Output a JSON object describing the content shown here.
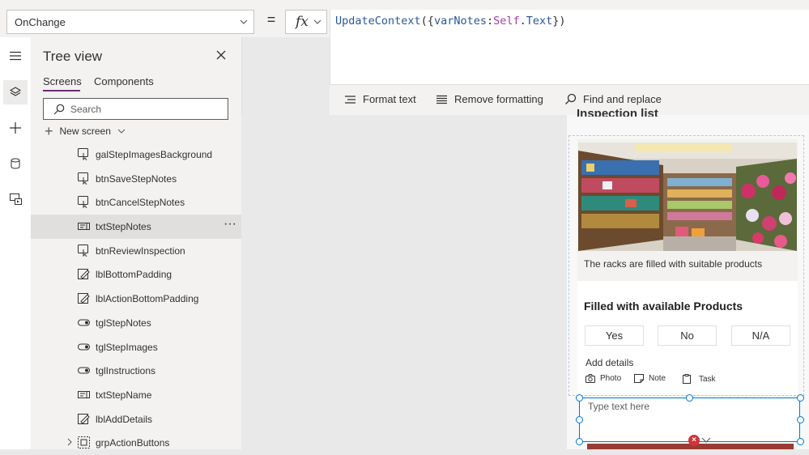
{
  "formula_bar": {
    "property": "OnChange",
    "equals": "=",
    "fx": "fx",
    "formula": {
      "fn": "UpdateContext",
      "open": "({",
      "var": "varNotes",
      "colon": ":",
      "self": "Self",
      "dot": ".",
      "prop": "Text",
      "close": "})"
    },
    "toolbar": {
      "format_text": "Format text",
      "remove_formatting": "Remove formatting",
      "find_replace": "Find and replace"
    }
  },
  "rail": {
    "icons": [
      "hamburger-icon",
      "layers-icon",
      "plus-icon",
      "database-icon",
      "media-icon"
    ]
  },
  "tree_view": {
    "title": "Tree view",
    "tabs": [
      "Screens",
      "Components"
    ],
    "active_tab": "Screens",
    "search_placeholder": "Search",
    "new_screen": "New screen",
    "items": [
      {
        "label": "galStepImagesBackground",
        "icon": "button-icon"
      },
      {
        "label": "btnSaveStepNotes",
        "icon": "button-icon"
      },
      {
        "label": "btnCancelStepNotes",
        "icon": "button-icon"
      },
      {
        "label": "txtStepNotes",
        "icon": "textinput-icon",
        "selected": true,
        "more": "···"
      },
      {
        "label": "btnReviewInspection",
        "icon": "button-icon"
      },
      {
        "label": "lblBottomPadding",
        "icon": "label-icon"
      },
      {
        "label": "lblActionBottomPadding",
        "icon": "label-icon"
      },
      {
        "label": "tglStepNotes",
        "icon": "toggle-icon"
      },
      {
        "label": "tglStepImages",
        "icon": "toggle-icon"
      },
      {
        "label": "tglInstructions",
        "icon": "toggle-icon"
      },
      {
        "label": "txtStepName",
        "icon": "textinput-icon"
      },
      {
        "label": "lblAddDetails",
        "icon": "label-icon"
      },
      {
        "label": "grpActionButtons",
        "icon": "group-icon",
        "expandable": true
      }
    ]
  },
  "canvas": {
    "heading": "Inspection list",
    "card": {
      "caption": "The racks are filled with suitable products",
      "title": "Filled with available Products",
      "options": [
        "Yes",
        "No",
        "N/A"
      ],
      "add_details": "Add details",
      "details": [
        "Photo",
        "Note",
        "Task"
      ]
    },
    "text_input_placeholder": "Type text here",
    "error_badge": "×"
  },
  "colors": {
    "accent": "#742774",
    "selection": "#0078d4",
    "error": "#d13438"
  }
}
